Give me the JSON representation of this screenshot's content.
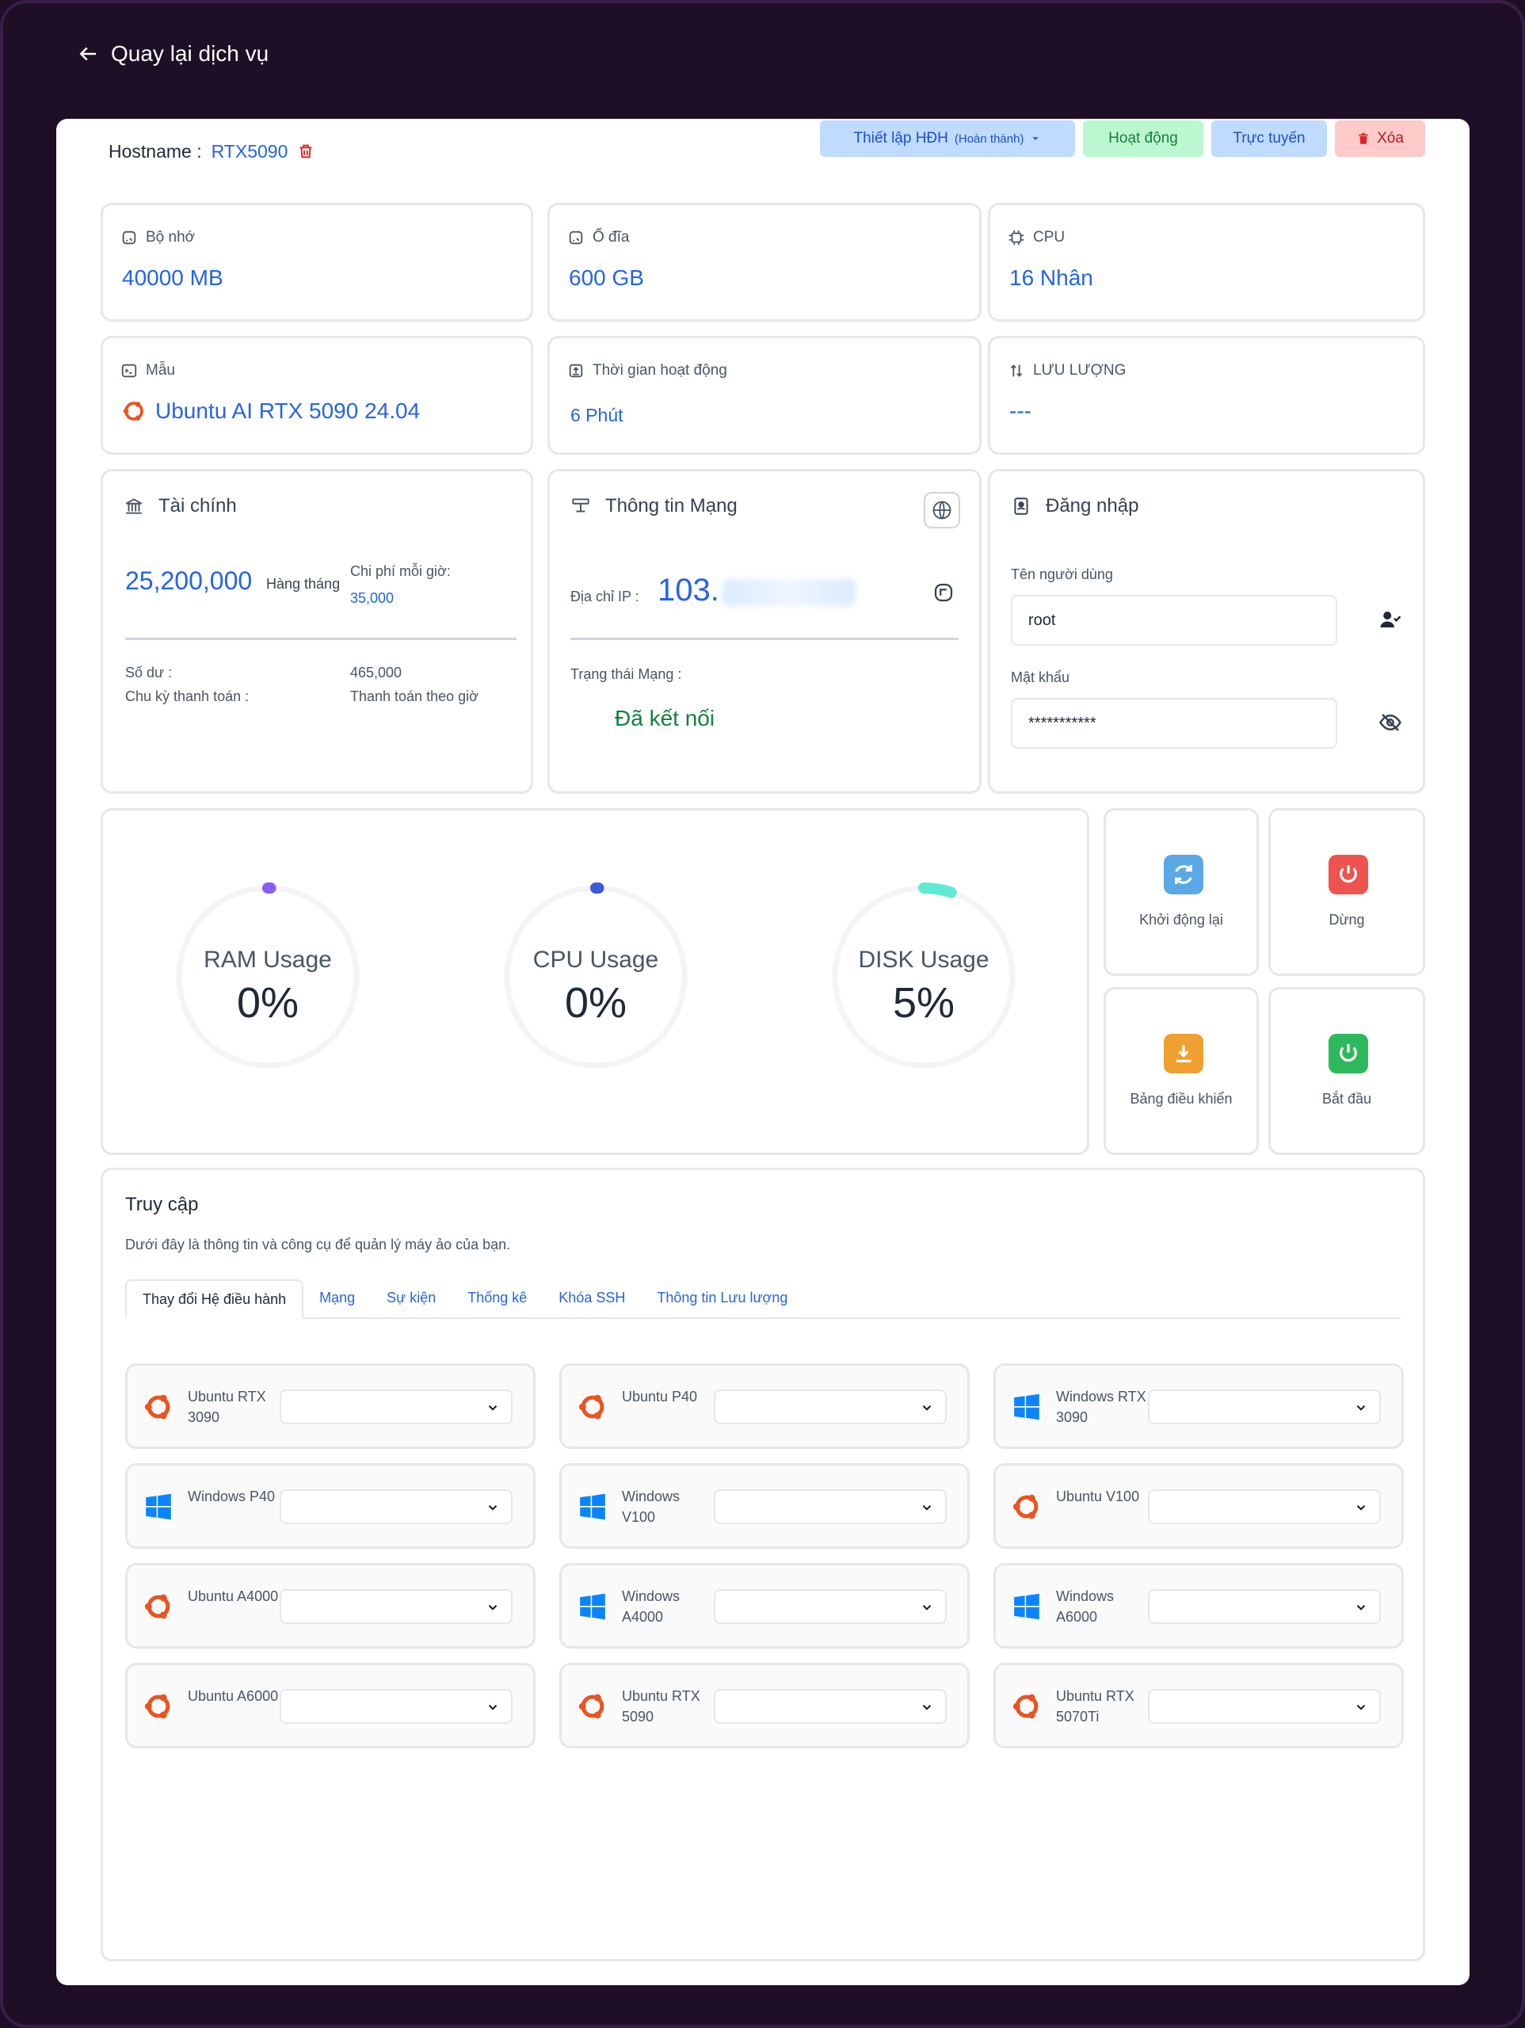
{
  "nav": {
    "back_label": "Quay lại dịch vụ"
  },
  "header": {
    "hostname_label": "Hostname :",
    "hostname_value": "RTX5090",
    "os_setup_label": "Thiết lập HĐH",
    "os_setup_status": "(Hoàn thành)",
    "active_label": "Hoạt động",
    "online_label": "Trực tuyến",
    "delete_label": "Xóa"
  },
  "stats": {
    "memory": {
      "label": "Bộ nhớ",
      "value": "40000 MB"
    },
    "disk": {
      "label": "Ổ đĩa",
      "value": "600 GB"
    },
    "cpu": {
      "label": "CPU",
      "value": "16 Nhân"
    },
    "template": {
      "label": "Mẫu",
      "value": "Ubuntu AI RTX 5090 24.04"
    },
    "uptime": {
      "label": "Thời gian hoạt động",
      "value": "6 Phút"
    },
    "traffic": {
      "label": "LƯU LƯỢNG",
      "value": "---"
    }
  },
  "finance": {
    "title": "Tài chính",
    "amount": "25,200,000",
    "period": "Hàng tháng",
    "hourly_label": "Chi phí mỗi giờ:",
    "hourly_value": "35,000",
    "balance_label": "Số dư :",
    "balance_value": "465,000",
    "cycle_label": "Chu kỳ thanh toán :",
    "cycle_value": "Thanh toán theo giờ"
  },
  "network": {
    "title": "Thông tin Mạng",
    "ip_label": "Địa chỉ IP :",
    "ip_value": "103.",
    "status_label": "Trạng thái Mạng :",
    "status_value": "Đã kết nối"
  },
  "login": {
    "title": "Đăng nhập",
    "username_label": "Tên người dùng",
    "username_value": "root",
    "password_label": "Mật khẩu",
    "password_value": "***********"
  },
  "usage": [
    {
      "label": "RAM Usage",
      "value": "0%",
      "percent": 0,
      "color": "#8b5cf6"
    },
    {
      "label": "CPU Usage",
      "value": "0%",
      "percent": 0,
      "color": "#3b5bdb"
    },
    {
      "label": "DISK Usage",
      "value": "5%",
      "percent": 5,
      "color": "#5eead4"
    }
  ],
  "actions": {
    "restart": {
      "label": "Khởi động lại",
      "color": "#5aa9e6"
    },
    "stop": {
      "label": "Dừng",
      "color": "#ef5350"
    },
    "console": {
      "label": "Bảng điều khiển",
      "color": "#f0a030"
    },
    "start": {
      "label": "Bắt đầu",
      "color": "#2eb85c"
    }
  },
  "access": {
    "title": "Truy cập",
    "description": "Dưới đây là thông tin và công cụ để quản lý máy ảo của bạn.",
    "tabs": [
      "Thay đổi Hệ điều hành",
      "Mạng",
      "Sự kiện",
      "Thống kê",
      "Khóa SSH",
      "Thông tin Lưu lượng"
    ],
    "os_options": [
      {
        "name": "Ubuntu RTX 3090",
        "os": "ubuntu"
      },
      {
        "name": "Ubuntu P40",
        "os": "ubuntu"
      },
      {
        "name": "Windows RTX 3090",
        "os": "windows"
      },
      {
        "name": "Windows P40",
        "os": "windows"
      },
      {
        "name": "Windows V100",
        "os": "windows"
      },
      {
        "name": "Ubuntu V100",
        "os": "ubuntu"
      },
      {
        "name": "Ubuntu A4000",
        "os": "ubuntu"
      },
      {
        "name": "Windows A4000",
        "os": "windows"
      },
      {
        "name": "Windows A6000",
        "os": "windows"
      },
      {
        "name": "Ubuntu A6000",
        "os": "ubuntu"
      },
      {
        "name": "Ubuntu RTX 5090",
        "os": "ubuntu"
      },
      {
        "name": "Ubuntu RTX 5070Ti",
        "os": "ubuntu"
      }
    ]
  },
  "colors": {
    "background": "#1e0f26",
    "accent": "#2563eb",
    "success": "#15803d",
    "danger": "#dc2626",
    "ubuntu": "#e95420",
    "windows": "#0a84ff"
  }
}
